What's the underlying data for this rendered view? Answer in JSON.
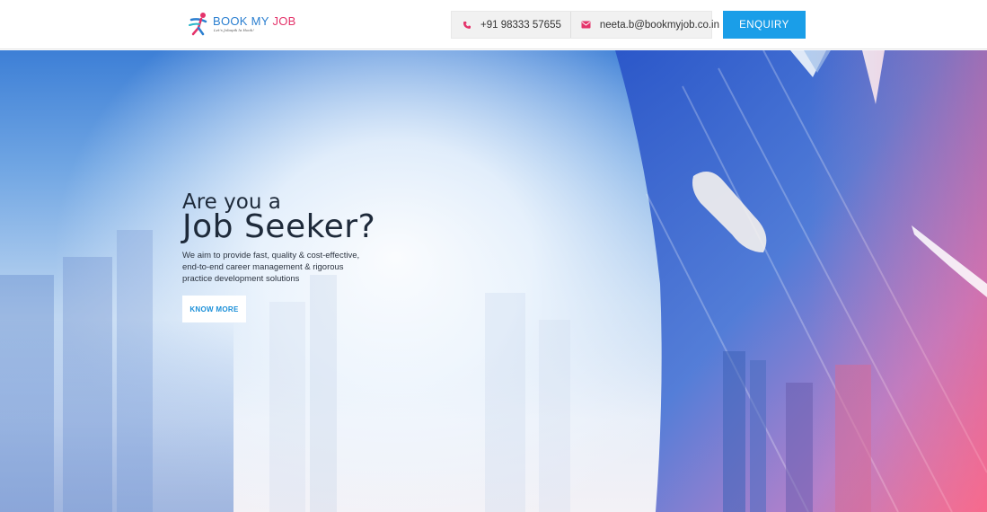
{
  "brand": {
    "name_part1": "BOOK MY ",
    "name_part2": "JOB",
    "tagline": "Let's Jobapik la Hook!"
  },
  "header": {
    "phone": "+91 98333 57655",
    "email": "neeta.b@bookmyjob.co.in",
    "enquiry_label": "ENQUIRY",
    "phone_icon": "phone-icon",
    "email_icon": "envelope-icon"
  },
  "hero": {
    "line1": "Are you a",
    "line2": "Job Seeker?",
    "description": "We aim to provide fast, quality & cost-effective, end-to-end career management & rigorous practice development solutions",
    "cta_label": "KNOW MORE"
  },
  "colors": {
    "accent_blue": "#1a9ee8",
    "brand_pink": "#e4336a",
    "brand_blue": "#2b7fd0"
  }
}
